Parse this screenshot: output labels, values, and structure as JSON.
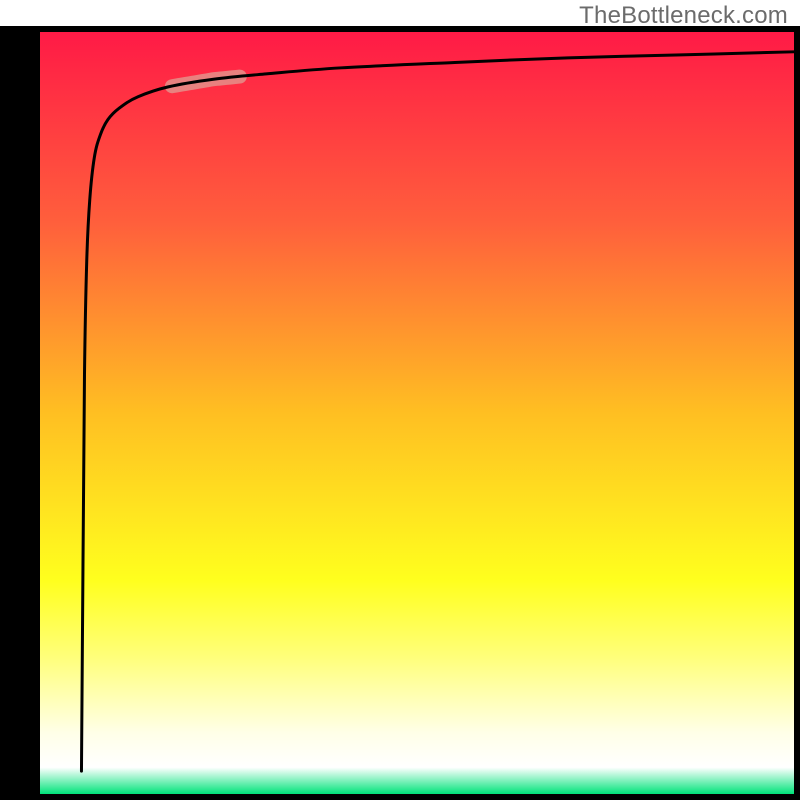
{
  "watermark": "TheBottleneck.com",
  "chart_data": {
    "type": "line",
    "title": "",
    "xlabel": "",
    "ylabel": "",
    "xlim": [
      0,
      100
    ],
    "ylim": [
      0,
      100
    ],
    "grid": false,
    "legend": "none",
    "background_gradient": {
      "stops": [
        {
          "offset": 0.0,
          "color": "#ff1a46"
        },
        {
          "offset": 0.25,
          "color": "#ff5f3c"
        },
        {
          "offset": 0.5,
          "color": "#ffbf22"
        },
        {
          "offset": 0.72,
          "color": "#ffff1e"
        },
        {
          "offset": 0.82,
          "color": "#ffff7a"
        },
        {
          "offset": 0.92,
          "color": "#ffffe8"
        },
        {
          "offset": 0.965,
          "color": "#ffffff"
        },
        {
          "offset": 1.0,
          "color": "#00e37a"
        }
      ]
    },
    "frame_color": "#000000",
    "frame_thickness_left": 40,
    "frame_thickness_other": 6,
    "series": [
      {
        "name": "bottleneck-curve",
        "color": "#000000",
        "stroke_width": 3,
        "x": [
          5.5,
          5.7,
          5.9,
          6.2,
          6.6,
          7.2,
          8.0,
          9.0,
          10.5,
          13.0,
          17.0,
          23.0,
          30.0,
          40.0,
          55.0,
          70.0,
          85.0,
          100.0
        ],
        "y": [
          3.0,
          30.0,
          55.0,
          70.0,
          78.0,
          83.5,
          86.5,
          88.5,
          90.0,
          91.5,
          92.8,
          93.8,
          94.5,
          95.3,
          96.0,
          96.6,
          97.0,
          97.4
        ]
      }
    ],
    "highlight_segment": {
      "color": "#e4908a",
      "stroke_width": 14,
      "opacity": 0.85,
      "x_range": [
        17.5,
        26.5
      ]
    }
  }
}
